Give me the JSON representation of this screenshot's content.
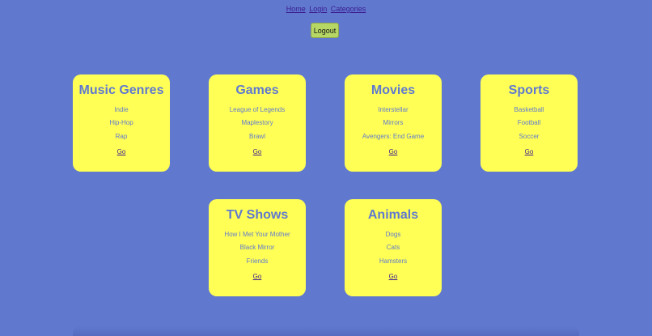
{
  "nav": {
    "links": [
      {
        "label": "Home"
      },
      {
        "label": "Login"
      },
      {
        "label": "Categories"
      }
    ]
  },
  "logout_label": "Logout",
  "cards": [
    {
      "title": "Music Genres",
      "items": [
        "Indie",
        "Hip-Hop",
        "Rap"
      ],
      "go_label": "Go"
    },
    {
      "title": "Games",
      "items": [
        "League of Legends",
        "Maplestory",
        "Brawl"
      ],
      "go_label": "Go"
    },
    {
      "title": "Movies",
      "items": [
        "Interstellar",
        "Mirrors",
        "Avengers: End Game"
      ],
      "go_label": "Go"
    },
    {
      "title": "Sports",
      "items": [
        "Basketball",
        "Football",
        "Soccer"
      ],
      "go_label": "Go"
    },
    {
      "title": "TV Shows",
      "items": [
        "How I Met Your Mother",
        "Black Mirror",
        "Friends"
      ],
      "go_label": "Go"
    },
    {
      "title": "Animals",
      "items": [
        "Dogs",
        "Cats",
        "Hamsters"
      ],
      "go_label": "Go"
    }
  ],
  "colors": {
    "background": "#6079cf",
    "card": "#ffff55",
    "button": "#b7d765",
    "link": "#3b1a8f"
  }
}
